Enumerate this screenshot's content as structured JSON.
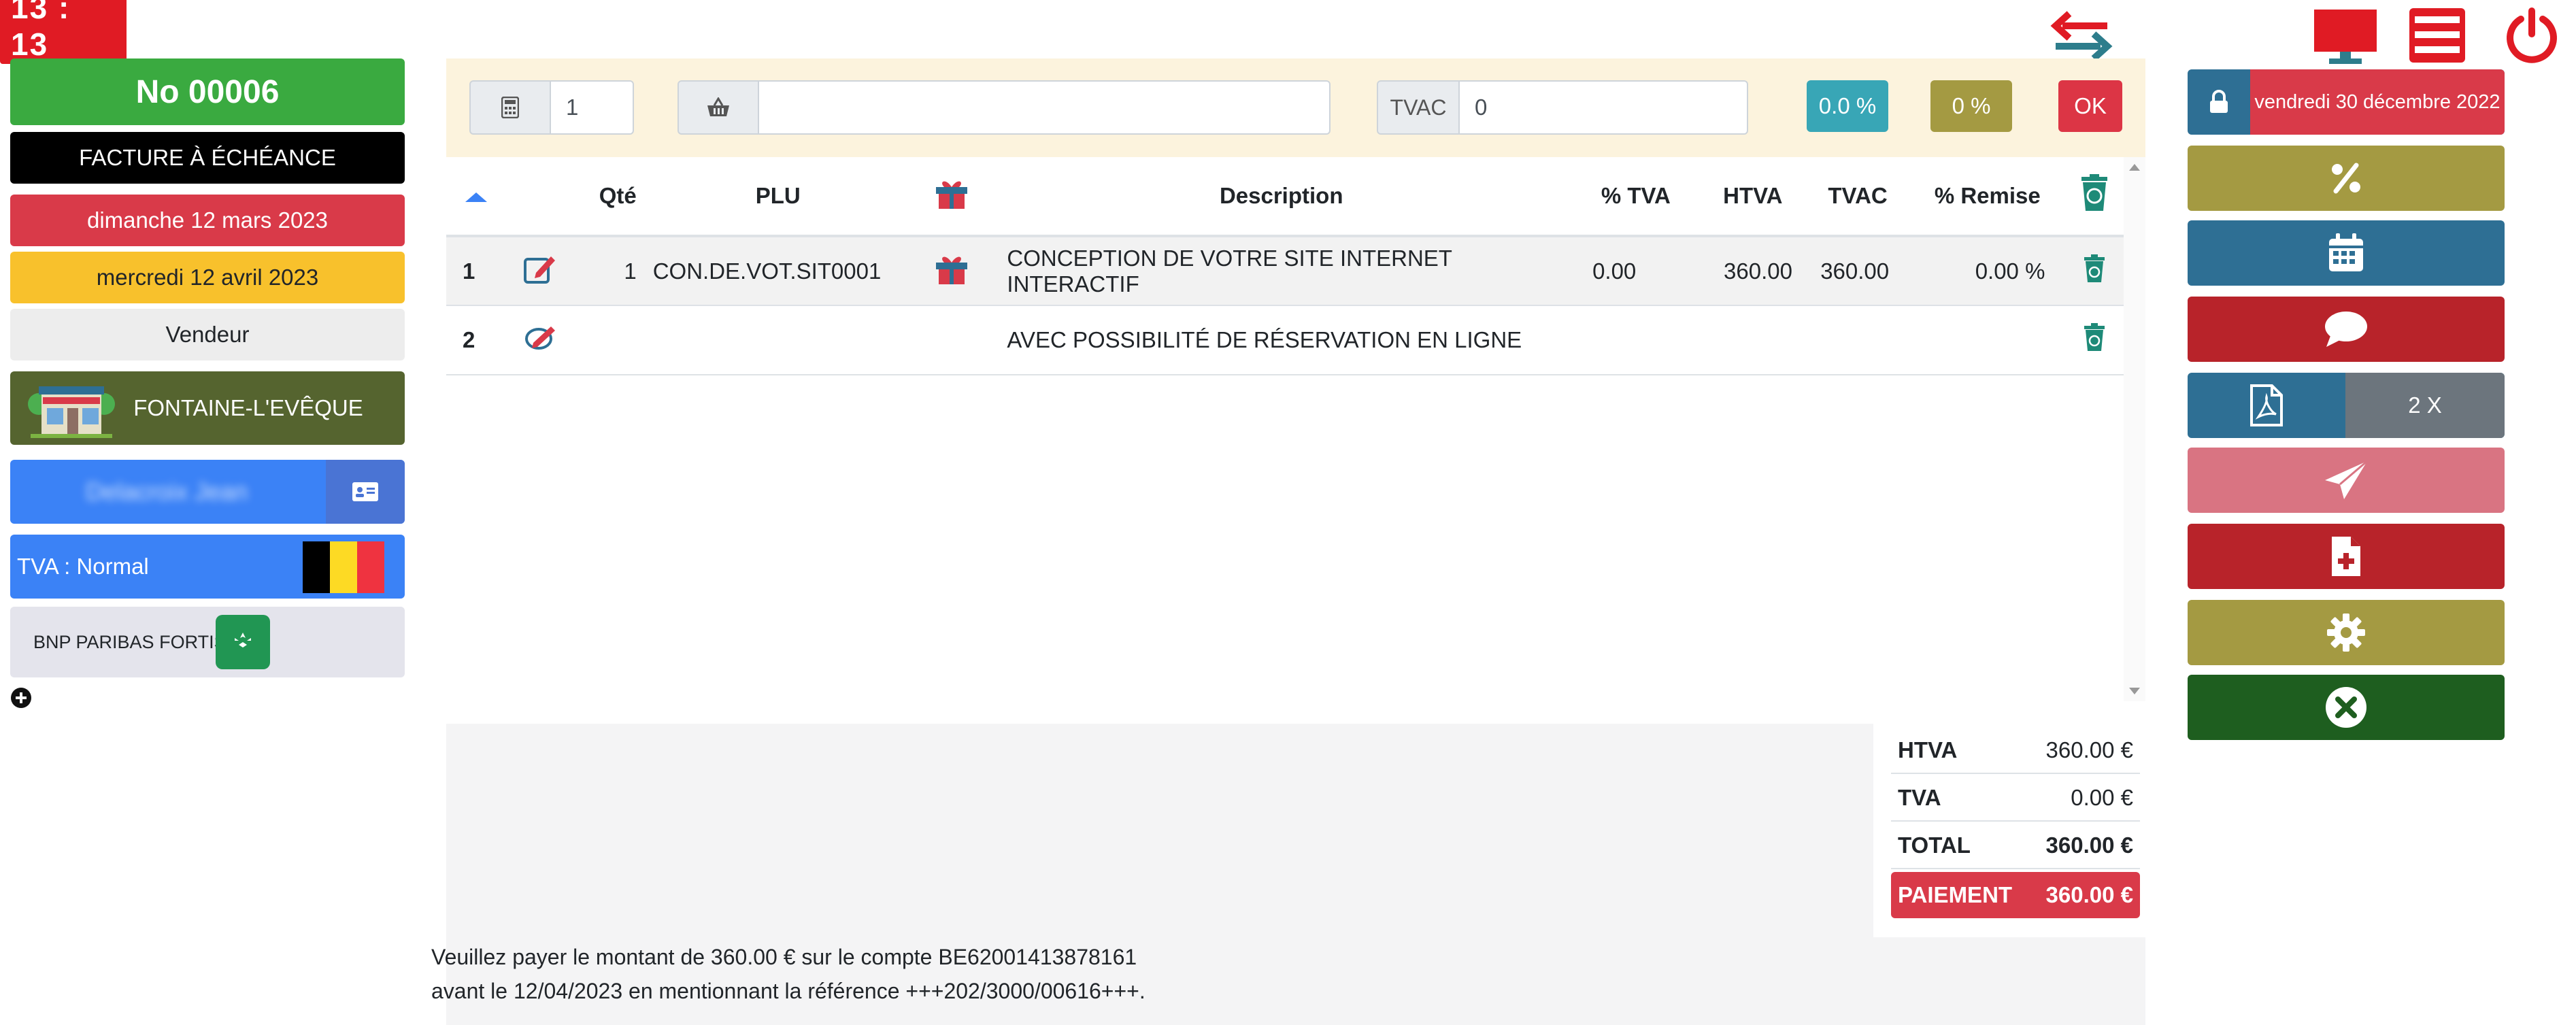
{
  "header": {
    "clock": "13 : 13"
  },
  "left": {
    "invoice_number": "No 00006",
    "invoice_type": "FACTURE À ÉCHÉANCE",
    "invoice_date": "dimanche 12 mars 2023",
    "due_date": "mercredi 12 avril 2023",
    "seller": "Vendeur",
    "shop": "FONTAINE-L'EVÊQUE",
    "client_name": "Delacroix Jean",
    "tva_regime": "TVA : Normal",
    "bank": "BNP PARIBAS FORTIS",
    "bank_logo_text": "BNP PARIBAS FORTIS"
  },
  "input_bar": {
    "qty_value": "1",
    "plu_value": "",
    "tvac_label": "TVAC",
    "tvac_value": "0",
    "pct1_label": "0.0 %",
    "pct2_label": "0 %",
    "ok_label": "OK"
  },
  "table": {
    "headers": {
      "qty": "Qté",
      "plu": "PLU",
      "description": "Description",
      "pct_tva": "% TVA",
      "htva": "HTVA",
      "tvac": "TVAC",
      "discount": "% Remise"
    },
    "rows": [
      {
        "num": "1",
        "qty": "1",
        "plu": "CON.DE.VOT.SIT0001",
        "description": "CONCEPTION DE VOTRE SITE INTERNET INTERACTIF",
        "pct_tva": "0.00",
        "htva": "360.00",
        "tvac": "360.00",
        "discount": "0.00 %"
      },
      {
        "num": "2",
        "qty": "",
        "plu": "",
        "description": "AVEC POSSIBILITÉ DE RÉSERVATION EN LIGNE",
        "pct_tva": "",
        "htva": "",
        "tvac": "",
        "discount": ""
      }
    ]
  },
  "totals": {
    "htva_label": "HTVA",
    "htva_value": "360.00 €",
    "tva_label": "TVA",
    "tva_value": "0.00 €",
    "total_label": "TOTAL",
    "total_value": "360.00 €",
    "payment_label": "PAIEMENT",
    "payment_value": "360.00 €"
  },
  "payment_text": {
    "line1": "Veuillez payer le montant de 360.00 € sur le compte BE62001413878161",
    "line2": "avant le 12/04/2023 en mentionnant la référence +++202/3000/00616+++."
  },
  "right": {
    "date": "vendredi 30 décembre 2022",
    "copies": "2 X"
  },
  "colors": {
    "green": "#3aaa40",
    "red": "#d93a49",
    "yellow": "#f8c12c",
    "olive": "#a49a42",
    "teal_blue": "#2e6f94",
    "blue": "#3b82f6",
    "dark_red": "#b8232a",
    "dark_green": "#1e5e1f"
  },
  "icons": [
    "swap-arrows-icon",
    "monitor-icon",
    "list-icon",
    "power-icon",
    "calculator-icon",
    "basket-icon",
    "sort-up-icon",
    "gift-icon",
    "recycle-icon",
    "edit-icon",
    "edit-disabled-icon",
    "trash-icon",
    "lock-icon",
    "percent-icon",
    "calendar-icon",
    "comment-icon",
    "pdf-icon",
    "send-icon",
    "new-document-icon",
    "gear-icon",
    "close-circle-icon",
    "plus-circle-icon",
    "id-card-icon",
    "belgium-flag-icon"
  ]
}
